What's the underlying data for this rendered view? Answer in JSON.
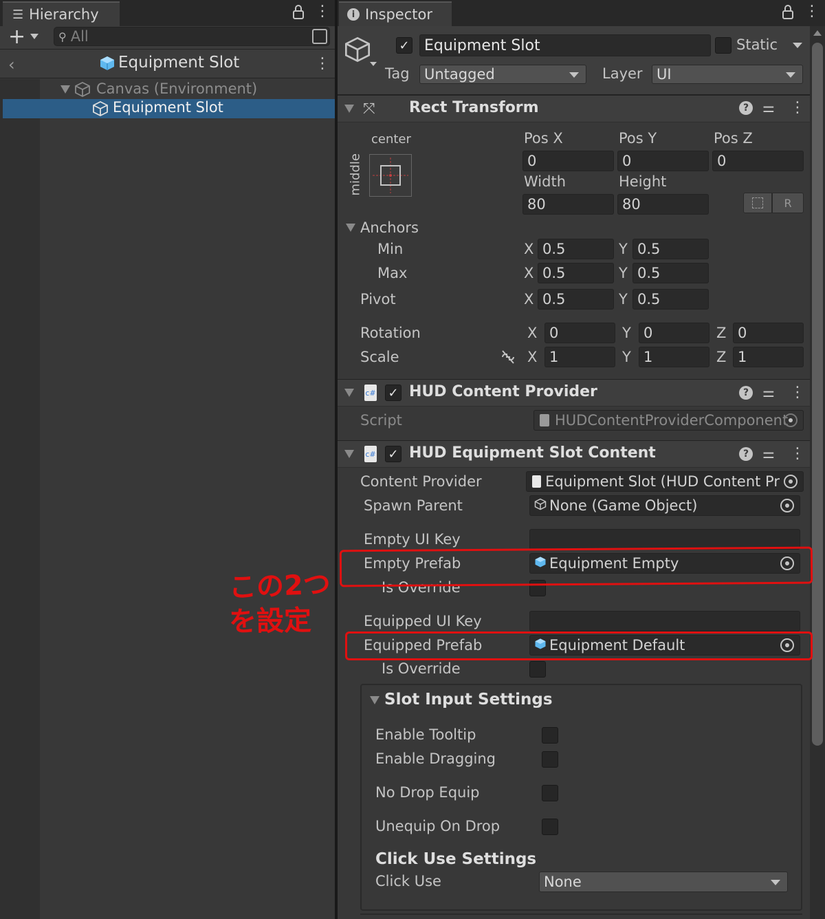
{
  "hierarchy": {
    "tab_label": "Hierarchy",
    "search_placeholder": "All",
    "scene_title": "Equipment Slot",
    "items": [
      {
        "label": "Canvas (Environment)"
      },
      {
        "label": "Equipment Slot"
      }
    ]
  },
  "inspector": {
    "tab_label": "Inspector",
    "object_name": "Equipment Slot",
    "static_label": "Static",
    "tag_label": "Tag",
    "tag_value": "Untagged",
    "layer_label": "Layer",
    "layer_value": "UI",
    "rect_transform": {
      "title": "Rect Transform",
      "anchor_h": "center",
      "anchor_v": "middle",
      "pos_x_label": "Pos X",
      "pos_x": "0",
      "pos_y_label": "Pos Y",
      "pos_y": "0",
      "pos_z_label": "Pos Z",
      "pos_z": "0",
      "width_label": "Width",
      "width": "80",
      "height_label": "Height",
      "height": "80",
      "r_button": "R",
      "anchors_label": "Anchors",
      "min_label": "Min",
      "min_x": "0.5",
      "min_y": "0.5",
      "max_label": "Max",
      "max_x": "0.5",
      "max_y": "0.5",
      "pivot_label": "Pivot",
      "pivot_x": "0.5",
      "pivot_y": "0.5",
      "rotation_label": "Rotation",
      "rot_x": "0",
      "rot_y": "0",
      "rot_z": "0",
      "scale_label": "Scale",
      "scale_x": "1",
      "scale_y": "1",
      "scale_z": "1",
      "x": "X",
      "y": "Y",
      "z": "Z"
    },
    "hud_content_provider": {
      "title": "HUD Content Provider",
      "script_label": "Script",
      "script_value": "HUDContentProviderComponent"
    },
    "hud_equipment_slot_content": {
      "title": "HUD Equipment Slot Content",
      "content_provider_label": "Content Provider",
      "content_provider_value": "Equipment Slot (HUD Content Pr",
      "spawn_parent_label": "Spawn Parent",
      "spawn_parent_value": "None (Game Object)",
      "empty_ui_key_label": "Empty UI Key",
      "empty_prefab_label": "Empty Prefab",
      "empty_prefab_value": "Equipment Empty",
      "is_override_label": "Is Override",
      "equipped_ui_key_label": "Equipped UI Key",
      "equipped_prefab_label": "Equipped Prefab",
      "equipped_prefab_value": "Equipment Default",
      "slot_input_title": "Slot Input Settings",
      "enable_tooltip_label": "Enable Tooltip",
      "enable_dragging_label": "Enable Dragging",
      "no_drop_equip_label": "No Drop Equip",
      "unequip_on_drop_label": "Unequip On Drop",
      "click_use_title": "Click Use Settings",
      "click_use_label": "Click Use",
      "click_use_value": "None"
    }
  },
  "annotation": {
    "text_line1": "この2つ",
    "text_line2": "を設定",
    "color": "#e01010"
  }
}
